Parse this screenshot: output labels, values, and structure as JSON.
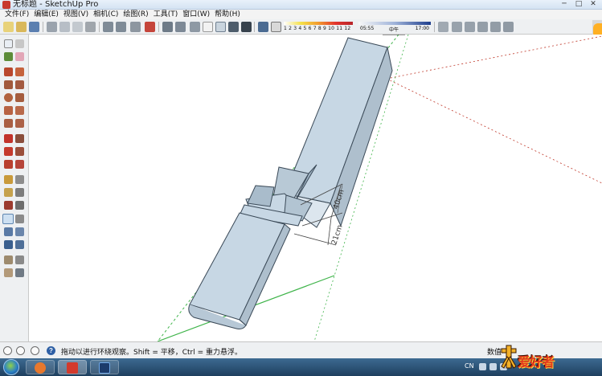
{
  "window": {
    "title": "无标题 - SketchUp Pro",
    "minimize": "─",
    "maximize": "□",
    "close": "✕"
  },
  "menubar": {
    "items": [
      "文件(F)",
      "编辑(E)",
      "视图(V)",
      "相机(C)",
      "绘图(R)",
      "工具(T)",
      "窗口(W)",
      "帮助(H)"
    ]
  },
  "shadow_settings": {
    "month_numbers": "1  2  3  4  5  6  7  8  9  10 11 12",
    "time_start": "05:55",
    "time_mid": "中午",
    "time_end": "17:00"
  },
  "viewport": {
    "dimension_1": "40cm",
    "dimension_2": "21cm"
  },
  "statusbar": {
    "hint": "拖动以进行环绕观察。Shift = 平移，Ctrl = 重力悬浮。",
    "measurement_label": "数值"
  },
  "taskbar": {
    "ime_label": "CN"
  },
  "watermark": {
    "text": "爱好者"
  },
  "colors": {
    "model_face": "#c7d7e4",
    "model_side": "#b9cad8",
    "edge_green": "#3fb44a",
    "axis_red": "#c0392b",
    "accent_orange": "#ffb024"
  }
}
